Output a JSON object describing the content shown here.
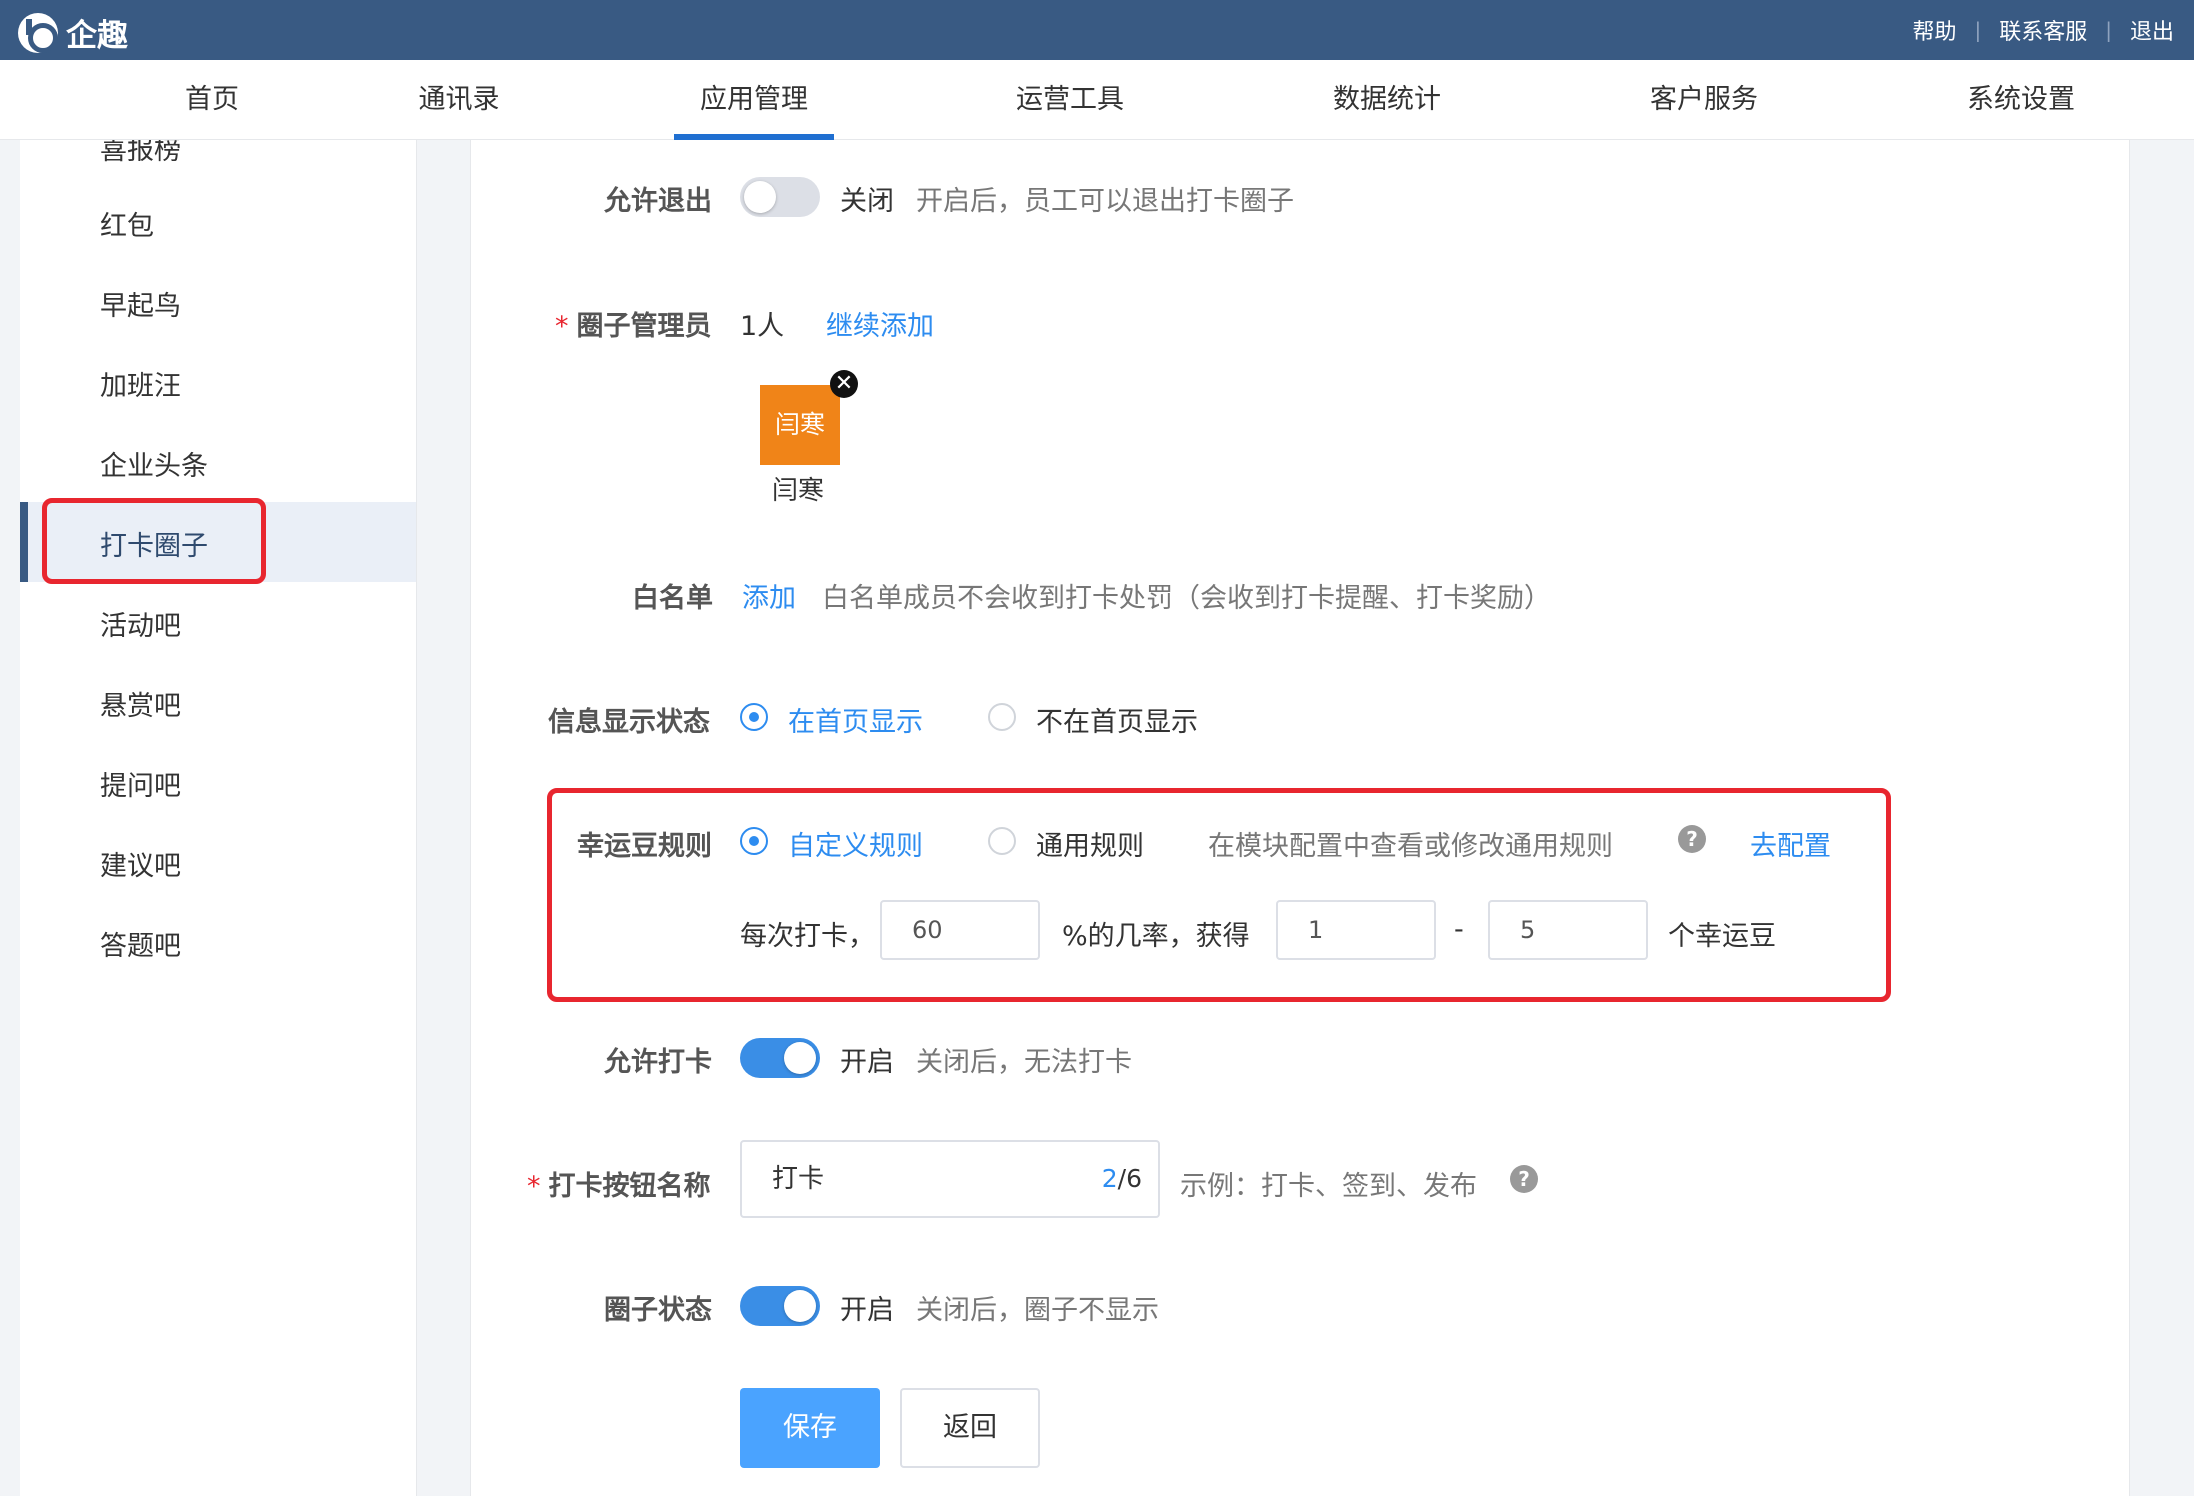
{
  "header": {
    "logo_text": "企趣",
    "links": [
      "帮助",
      "联系客服",
      "退出"
    ]
  },
  "nav": {
    "items": [
      "首页",
      "通讯录",
      "应用管理",
      "运营工具",
      "数据统计",
      "客户服务",
      "系统设置"
    ],
    "active": "应用管理"
  },
  "sidebar": {
    "items": [
      "喜报榜",
      "红包",
      "早起鸟",
      "加班汪",
      "企业头条",
      "打卡圈子",
      "活动吧",
      "悬赏吧",
      "提问吧",
      "建议吧",
      "答题吧"
    ],
    "active": "打卡圈子"
  },
  "form": {
    "allow_exit": {
      "label": "允许退出",
      "state": "关闭",
      "hint": "开启后，员工可以退出打卡圈子"
    },
    "admins": {
      "required": "*",
      "label": "圈子管理员",
      "count": "1人",
      "add_link": "继续添加",
      "avatar_text": "闫寒",
      "avatar_name": "闫寒",
      "remove_glyph": "✕"
    },
    "whitelist": {
      "label": "白名单",
      "add_link": "添加",
      "hint": "白名单成员不会收到打卡处罚（会收到打卡提醒、打卡奖励）"
    },
    "display": {
      "label": "信息显示状态",
      "option_on": "在首页显示",
      "option_off": "不在首页显示"
    },
    "lucky": {
      "label": "幸运豆规则",
      "option_custom": "自定义规则",
      "option_common": "通用规则",
      "hint": "在模块配置中查看或修改通用规则",
      "help_glyph": "?",
      "config_link": "去配置",
      "per_checkin": "每次打卡，",
      "rate_value": "60",
      "rate_suffix": "%的几率，获得",
      "min_value": "1",
      "dash": "-",
      "max_value": "5",
      "unit": "个幸运豆"
    },
    "allow_checkin": {
      "label": "允许打卡",
      "state": "开启",
      "hint": "关闭后，无法打卡"
    },
    "button_name": {
      "required": "*",
      "label": "打卡按钮名称",
      "value": "打卡",
      "count_used": "2",
      "count_max": "/6",
      "hint": "示例：打卡、签到、发布",
      "help_glyph": "?"
    },
    "circle_status": {
      "label": "圈子状态",
      "state": "开启",
      "hint": "关闭后，圈子不显示"
    },
    "actions": {
      "save": "保存",
      "back": "返回"
    }
  },
  "colors": {
    "header_bg": "#395a83",
    "accent": "#2d8cf0",
    "highlight": "#e8262f",
    "avatar_bg": "#f08418"
  }
}
